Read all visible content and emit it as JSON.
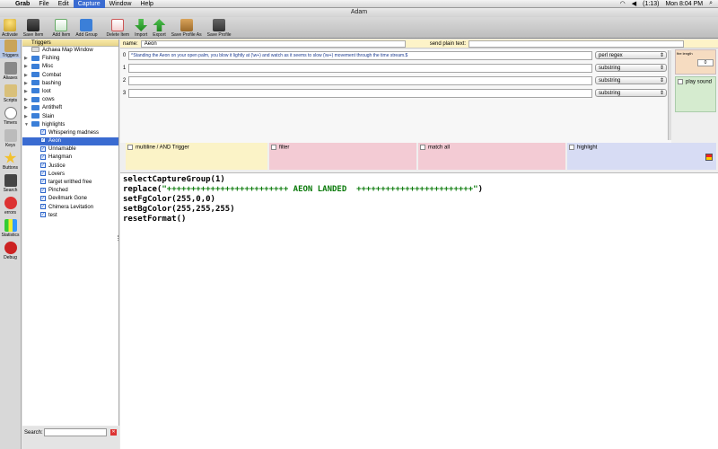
{
  "menubar": {
    "app": "Grab",
    "items": [
      "File",
      "Edit",
      "Capture",
      "Window",
      "Help"
    ],
    "selected": "Capture",
    "battery": "(1:13)",
    "clock": "Mon 8:04 PM"
  },
  "window": {
    "title": "Adam"
  },
  "toolbar": {
    "buttons": [
      "Activate",
      "Save Item",
      "Add Item",
      "Add Group",
      "Delete Item",
      "Import",
      "Export",
      "Save Profile As",
      "Save Profile"
    ]
  },
  "leftbar": {
    "items": [
      "Triggers",
      "Aliases",
      "Scripts",
      "Timers",
      "Keys",
      "Buttons",
      "Search",
      "errors",
      "Statistics",
      "Debug"
    ]
  },
  "tree": {
    "header": "Triggers",
    "folders": [
      "Achaea Map Window",
      "Fishing",
      "Misc",
      "Combat",
      "bashing",
      "loot",
      "cows",
      "Antitheft",
      "Slain",
      "highlights"
    ],
    "children": [
      "Whispering madness",
      "Aeon",
      "Unnamable",
      "Hangman",
      "Justice",
      "Lovers",
      "target writhed free",
      "Pinched",
      "Devilmark Gone",
      "Chimera Levitation",
      "test"
    ],
    "selected": "Aeon"
  },
  "search": {
    "label": "Search:"
  },
  "namebar": {
    "name_label": "name:",
    "name_value": "Aeon",
    "send_label": "send plain text:"
  },
  "patterns": [
    {
      "num": "0",
      "text": "^Standing the Aeon on your open palm, you blow it lightly at (\\w+) and watch as it seems to slow (\\w+) movement through the time stream.$",
      "type": "perl regex"
    },
    {
      "num": "1",
      "text": "",
      "type": "substring"
    },
    {
      "num": "2",
      "text": "",
      "type": "substring"
    },
    {
      "num": "3",
      "text": "",
      "type": "substring"
    }
  ],
  "fire": {
    "label": "fire length",
    "value": "0"
  },
  "sound": {
    "label": "play sound"
  },
  "options": {
    "multiline": "multiline / AND Trigger",
    "filter": "filter",
    "match_all": "match all",
    "highlight": "highlight"
  },
  "code": [
    {
      "fn": "selectCaptureGroup(1)"
    },
    {
      "pre": "replace(",
      "str": "\"+++++++++++++++++++++++++ AEON LANDED  ++++++++++++++++++++++++\"",
      "post": ")"
    },
    {
      "fn": "setFgColor(255,0,0)"
    },
    {
      "fn": "setBgColor(255,255,255)"
    },
    {
      "fn": "resetFormat()"
    }
  ],
  "colors": {
    "selection": "#3a6bd1",
    "folder": "#3b7fd8",
    "filter_bg": "#f3cbd4",
    "multiline_bg": "#fbf3c7",
    "highlight_bg": "#d7dcf4"
  }
}
